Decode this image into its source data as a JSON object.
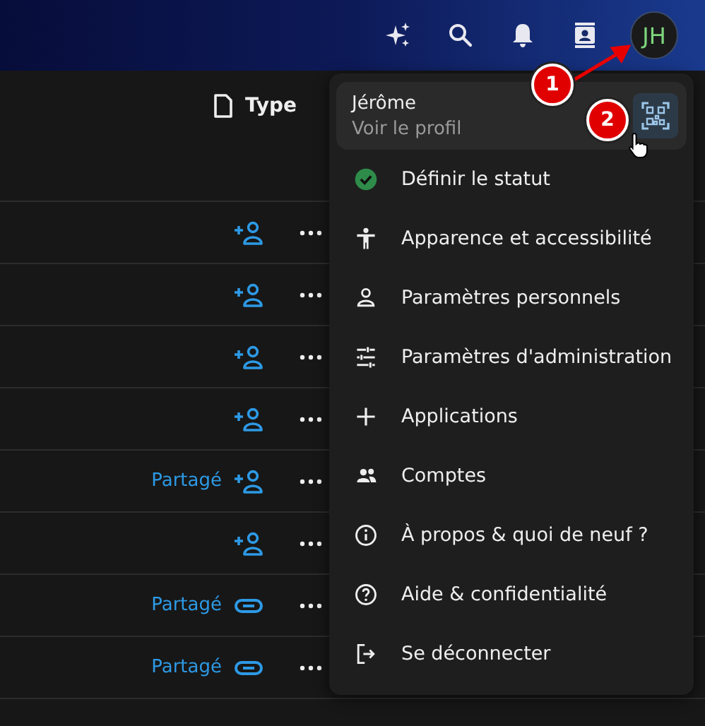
{
  "header": {
    "avatar_initials": "JH"
  },
  "table": {
    "columns": [
      "Type"
    ],
    "rows": [
      {
        "kind": "share"
      },
      {
        "kind": "share"
      },
      {
        "kind": "share"
      },
      {
        "kind": "share"
      },
      {
        "status": "Partagé",
        "kind": "share"
      },
      {
        "kind": "share"
      },
      {
        "status": "Partagé",
        "kind": "link"
      },
      {
        "status": "Partagé",
        "kind": "link"
      }
    ]
  },
  "user_menu": {
    "profile": {
      "name": "Jérôme",
      "subtitle": "Voir le profil"
    },
    "items": [
      {
        "kind": "status",
        "label": "Définir le statut"
      },
      {
        "kind": "accessibility",
        "label": "Apparence et accessibilité"
      },
      {
        "kind": "person",
        "label": "Paramètres personnels"
      },
      {
        "kind": "sliders",
        "label": "Paramètres d'administration"
      },
      {
        "kind": "plus",
        "label": "Applications"
      },
      {
        "kind": "group",
        "label": "Comptes"
      },
      {
        "kind": "info",
        "label": "À propos & quoi de neuf ?"
      },
      {
        "kind": "help",
        "label": "Aide & confidentialité"
      },
      {
        "kind": "logout",
        "label": "Se déconnecter"
      }
    ]
  },
  "annotations": [
    "1",
    "2"
  ]
}
